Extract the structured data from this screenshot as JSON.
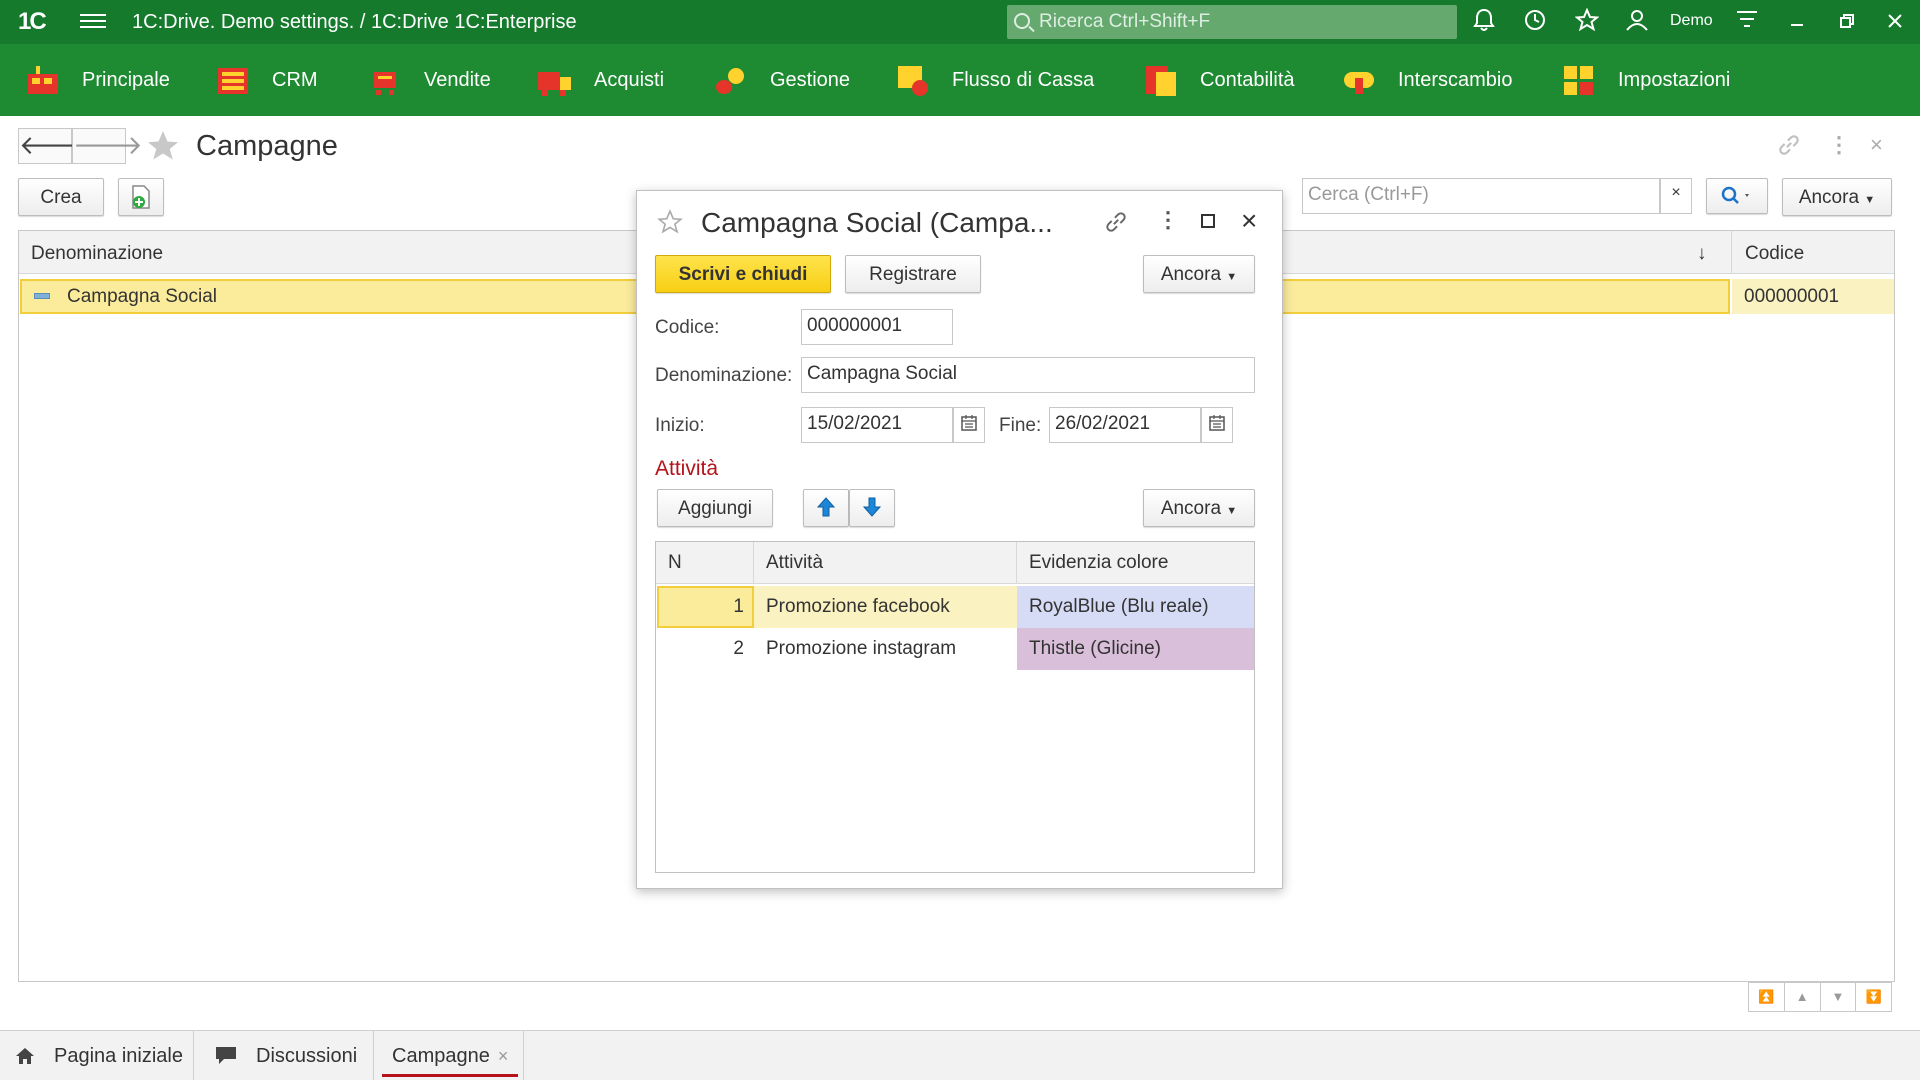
{
  "titlebar": {
    "logo": "1C",
    "title": "1C:Drive. Demo settings. / 1C:Drive 1C:Enterprise",
    "search_placeholder": "Ricerca Ctrl+Shift+F",
    "user": "Demo"
  },
  "sections": [
    {
      "label": "Principale"
    },
    {
      "label": "CRM"
    },
    {
      "label": "Vendite"
    },
    {
      "label": "Acquisti"
    },
    {
      "label": "Gestione"
    },
    {
      "label": "Flusso di Cassa"
    },
    {
      "label": "Contabilità"
    },
    {
      "label": "Interscambio"
    },
    {
      "label": "Impostazioni"
    }
  ],
  "page": {
    "title": "Campagne",
    "create_label": "Crea",
    "search_placeholder": "Cerca (Ctrl+F)",
    "more_label": "Ancora"
  },
  "list": {
    "columns": [
      "Denominazione",
      "Codice"
    ],
    "sort_indicator": "↓",
    "rows": [
      {
        "name": "Campagna Social",
        "code": "000000001"
      }
    ]
  },
  "dialog": {
    "title": "Campagna Social (Campa...",
    "save_close_label": "Scrivi e chiudi",
    "save_label": "Registrare",
    "more_label": "Ancora",
    "code_label": "Codice:",
    "code_value": "000000001",
    "name_label": "Denominazione:",
    "name_value": "Campagna Social",
    "start_label": "Inizio:",
    "start_value": "15/02/2021",
    "end_label": "Fine:",
    "end_value": "26/02/2021",
    "activities_title": "Attività",
    "add_label": "Aggiungi",
    "grid": {
      "columns": [
        "N",
        "Attività",
        "Evidenzia colore"
      ],
      "rows": [
        {
          "n": "1",
          "activity": "Promozione facebook",
          "color": "RoyalBlue (Blu reale)",
          "bg": "#d6dcf5"
        },
        {
          "n": "2",
          "activity": "Promozione instagram",
          "color": "Thistle (Glicine)",
          "bg": "#d9bfda"
        }
      ]
    }
  },
  "tabs": [
    {
      "label": "Pagina iniziale"
    },
    {
      "label": "Discussioni"
    },
    {
      "label": "Campagne"
    }
  ],
  "colors": {
    "titlebar": "#157a2c",
    "sections": "#1e8a31",
    "accent_red": "#b5121b",
    "selection": "#fbec9c"
  }
}
